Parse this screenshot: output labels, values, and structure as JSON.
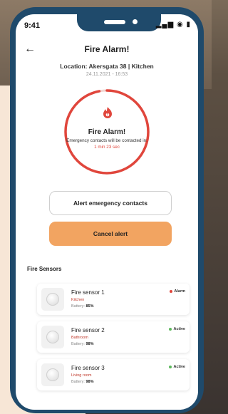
{
  "status_bar": {
    "time": "9:41",
    "icons": "▂▄▆ ◉ ▮"
  },
  "header": {
    "back_icon": "arrow-left-icon",
    "title": "Fire Alarm!"
  },
  "location": {
    "text": "Location: Akersgata 38 | Kitchen",
    "timestamp": "24.11.2021 - 16:53"
  },
  "alarm": {
    "icon": "flame-icon",
    "title": "Fire Alarm!",
    "message_prefix": "Emergency contacts will be contacted in:",
    "countdown": "1 min 23 sec",
    "ring_color": "#e0463c",
    "ring_fraction": 0.97
  },
  "buttons": {
    "alert_contacts": "Alert emergency contacts",
    "cancel": "Cancel alert"
  },
  "sensors_section": {
    "title": "Fire Sensors",
    "items": [
      {
        "name": "Fire sensor 1",
        "room": "Kitchen",
        "battery_label": "Battery:",
        "battery": "85%",
        "status": "Alarm",
        "status_color": "#e0463c"
      },
      {
        "name": "Fire sensor 2",
        "room": "Bathroom",
        "battery_label": "Battery:",
        "battery": "98%",
        "status": "Active",
        "status_color": "#5cb85c"
      },
      {
        "name": "Fire sensor 3",
        "room": "Living room",
        "battery_label": "Battery:",
        "battery": "98%",
        "status": "Active",
        "status_color": "#5cb85c"
      }
    ]
  }
}
